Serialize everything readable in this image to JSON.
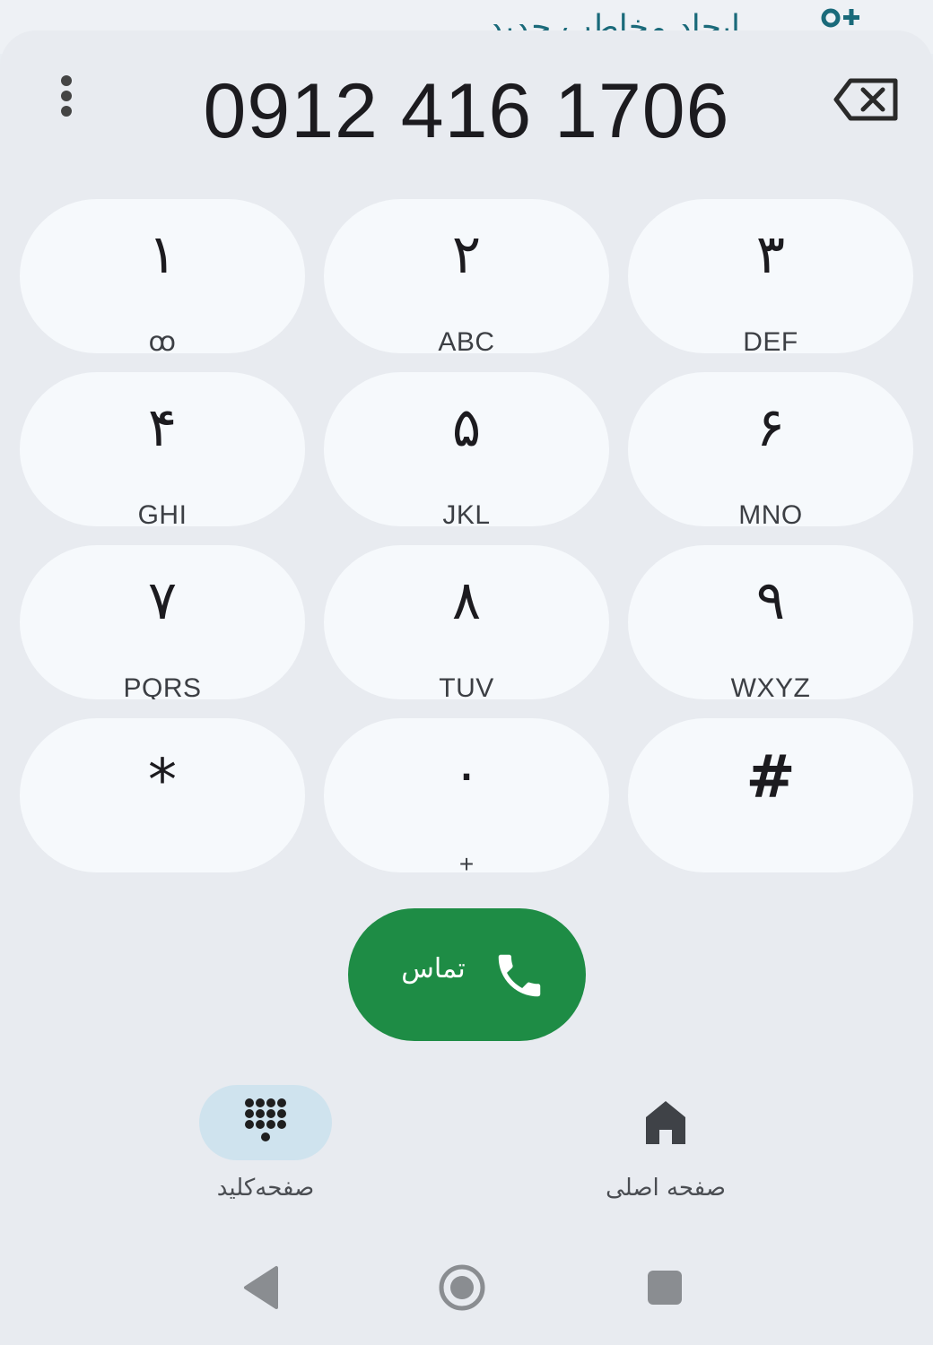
{
  "behind": {
    "create_contact_label": "ایجاد مخاطب جدید",
    "create_contact_icon": "person-add-icon"
  },
  "dialer": {
    "number": "0912 416 1706",
    "more_icon": "more-vert-icon",
    "backspace_icon": "backspace-icon"
  },
  "keypad": {
    "keys": [
      {
        "digit": "۱",
        "letters": "ꝏ"
      },
      {
        "digit": "۲",
        "letters": "ABC"
      },
      {
        "digit": "۳",
        "letters": "DEF"
      },
      {
        "digit": "۴",
        "letters": "GHI"
      },
      {
        "digit": "۵",
        "letters": "JKL"
      },
      {
        "digit": "۶",
        "letters": "MNO"
      },
      {
        "digit": "۷",
        "letters": "PQRS"
      },
      {
        "digit": "۸",
        "letters": "TUV"
      },
      {
        "digit": "۹",
        "letters": "WXYZ"
      },
      {
        "digit": "*",
        "letters": ""
      },
      {
        "digit": "۰",
        "letters": "+"
      },
      {
        "digit": "#",
        "letters": ""
      }
    ]
  },
  "call": {
    "label": "تماس",
    "icon": "phone-icon",
    "color": "#1e8c45"
  },
  "bottom_nav": {
    "items": [
      {
        "label": "صفحه‌کلید",
        "icon": "dialpad-icon",
        "active": true
      },
      {
        "label": "صفحه اصلی",
        "icon": "home-icon",
        "active": false
      }
    ]
  },
  "system_nav": {
    "back_icon": "back-triangle-icon",
    "home_icon": "home-circle-icon",
    "recents_icon": "recents-square-icon"
  }
}
